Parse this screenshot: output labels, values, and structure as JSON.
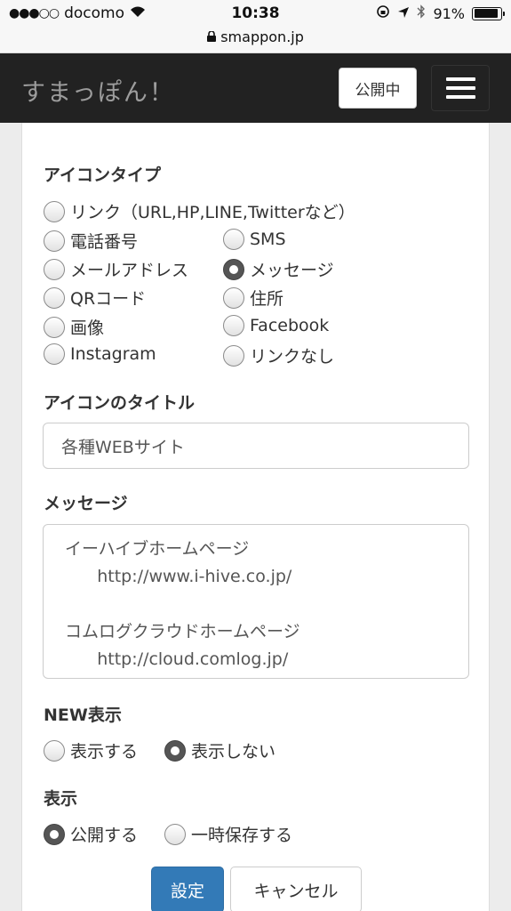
{
  "status_bar": {
    "carrier": "docomo",
    "time": "10:38",
    "url": "smappon.jp",
    "battery": "91%",
    "battery_level": 0.91
  },
  "navbar": {
    "brand": "すまっぽん！",
    "status_button": "公開中"
  },
  "form": {
    "icon_type": {
      "label": "アイコンタイプ",
      "options": [
        {
          "label": "リンク（URL,HP,LINE,Twitterなど）",
          "checked": false
        },
        {
          "label": "電話番号",
          "checked": false
        },
        {
          "label": "SMS",
          "checked": false
        },
        {
          "label": "メールアドレス",
          "checked": false
        },
        {
          "label": "メッセージ",
          "checked": true
        },
        {
          "label": "QRコード",
          "checked": false
        },
        {
          "label": "住所",
          "checked": false
        },
        {
          "label": "画像",
          "checked": false
        },
        {
          "label": "Facebook",
          "checked": false
        },
        {
          "label": "Instagram",
          "checked": false
        },
        {
          "label": "リンクなし",
          "checked": false
        }
      ]
    },
    "icon_title": {
      "label": "アイコンのタイトル",
      "value": "各種WEBサイト"
    },
    "message": {
      "label": "メッセージ",
      "value": "イーハイブホームページ\n      http://www.i-hive.co.jp/\n\nコムログクラウドホームページ\n      http://cloud.comlog.jp/"
    },
    "new_display": {
      "label": "NEW表示",
      "options": [
        {
          "label": "表示する",
          "checked": false
        },
        {
          "label": "表示しない",
          "checked": true
        }
      ]
    },
    "display": {
      "label": "表示",
      "options": [
        {
          "label": "公開する",
          "checked": true
        },
        {
          "label": "一時保存する",
          "checked": false
        }
      ]
    },
    "buttons": {
      "save": "設定",
      "cancel": "キャンセル"
    }
  }
}
